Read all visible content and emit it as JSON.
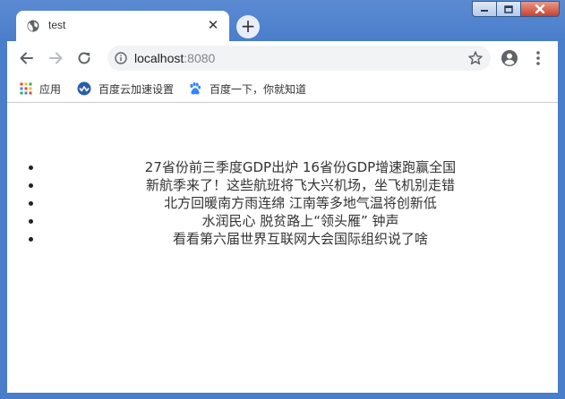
{
  "window": {
    "controls": [
      "minimize",
      "maximize",
      "close"
    ]
  },
  "tab": {
    "title": "test",
    "favicon": "globe-icon",
    "close_glyph": "✕"
  },
  "new_tab_glyph": "+",
  "toolbar": {
    "back_icon": "back-arrow-icon",
    "forward_icon": "forward-arrow-icon",
    "reload_icon": "reload-icon",
    "url_host": "localhost",
    "url_port": ":8080",
    "bookmark_icon": "star-icon",
    "profile_icon": "account-icon",
    "menu_icon": "kebab-menu-icon"
  },
  "bookmarks": [
    {
      "label": "应用",
      "icon": "apps-grid-icon"
    },
    {
      "label": "百度云加速设置",
      "icon": "cloud-accelerate-icon"
    },
    {
      "label": "百度一下，你就知道",
      "icon": "baidu-paw-icon"
    }
  ],
  "news": [
    "27省份前三季度GDP出炉 16省份GDP增速跑赢全国",
    "新航季来了！这些航班将飞大兴机场，坐飞机别走错",
    "北方回暖南方雨连绵 江南等多地气温将创新低",
    "水润民心 脱贫路上“领头雁” 钟声",
    "看看第六届世界互联网大会国际组织说了啥"
  ],
  "colors": {
    "frame": "#4a7ecb",
    "text": "#333333",
    "omnibox": "#f1f3f4"
  }
}
